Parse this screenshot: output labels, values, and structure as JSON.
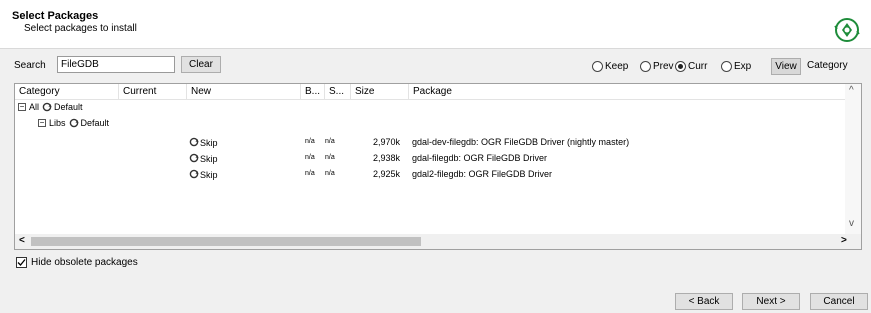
{
  "header": {
    "title": "Select Packages",
    "subtitle": "Select packages to install",
    "logo_icon": "cygwin-setup-logo"
  },
  "toolbar": {
    "search_label": "Search",
    "search_value": "FileGDB",
    "clear_label": "Clear",
    "radios": [
      {
        "label": "Keep",
        "checked": false
      },
      {
        "label": "Prev",
        "checked": false
      },
      {
        "label": "Curr",
        "checked": true
      },
      {
        "label": "Exp",
        "checked": false
      }
    ],
    "view_label": "View",
    "view_mode": "Category"
  },
  "list": {
    "columns": [
      "Category",
      "Current",
      "New",
      "B...",
      "S...",
      "Size",
      "Package"
    ],
    "tree": [
      {
        "label": "All",
        "action": "Default"
      },
      {
        "label": "Libs",
        "action": "Default"
      }
    ],
    "rows": [
      {
        "new": "Skip",
        "bin": "n/a",
        "src": "n/a",
        "size": "2,970k",
        "package": "gdal-dev-filegdb: OGR FileGDB Driver (nightly master)"
      },
      {
        "new": "Skip",
        "bin": "n/a",
        "src": "n/a",
        "size": "2,938k",
        "package": "gdal-filegdb: OGR FileGDB Driver"
      },
      {
        "new": "Skip",
        "bin": "n/a",
        "src": "n/a",
        "size": "2,925k",
        "package": "gdal2-filegdb: OGR FileGDB Driver"
      }
    ]
  },
  "options": {
    "hide_obsolete_label": "Hide obsolete packages",
    "hide_obsolete_checked": true
  },
  "footer": {
    "back_label": "< Back",
    "next_label": "Next >",
    "cancel_label": "Cancel"
  },
  "colors": {
    "logo_green": "#1e8c3a",
    "window_bg": "#f0f0f0"
  }
}
